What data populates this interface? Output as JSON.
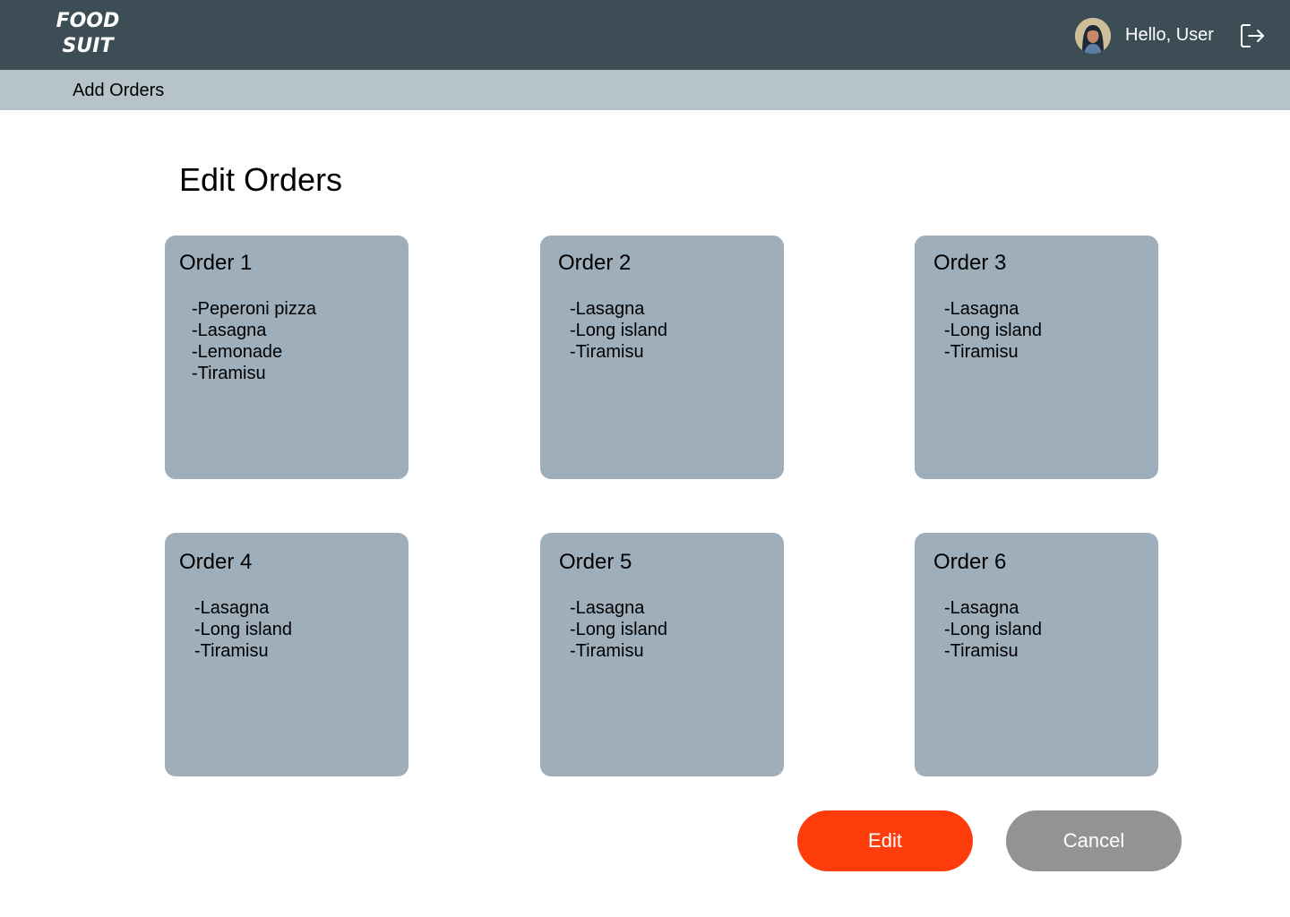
{
  "header": {
    "logo_line1": "FOOD",
    "logo_line2": "SUIT",
    "greeting": "Hello, User",
    "avatar_icon": "user-avatar",
    "logout_icon": "logout-icon",
    "background_color": "#3d4d55"
  },
  "subnav": {
    "add_orders_label": "Add Orders",
    "background_color": "#b6c3c8"
  },
  "main": {
    "title": "Edit Orders",
    "orders": [
      {
        "title": "Order 1",
        "items": [
          "-Peperoni pizza",
          "-Lasagna",
          "-Lemonade",
          "-Tiramisu"
        ]
      },
      {
        "title": "Order 2",
        "items": [
          "-Lasagna",
          "-Long island",
          "-Tiramisu"
        ]
      },
      {
        "title": "Order 3",
        "items": [
          "-Lasagna",
          "-Long island",
          "-Tiramisu"
        ]
      },
      {
        "title": "Order 4",
        "items": [
          "-Lasagna",
          "-Long island",
          "-Tiramisu"
        ]
      },
      {
        "title": "Order 5",
        "items": [
          "-Lasagna",
          "-Long island",
          "-Tiramisu"
        ]
      },
      {
        "title": "Order 6",
        "items": [
          "-Lasagna",
          "-Long island",
          "-Tiramisu"
        ]
      }
    ],
    "card_color": "#9faebb"
  },
  "actions": {
    "edit_label": "Edit",
    "cancel_label": "Cancel",
    "edit_color": "#ff3d0c",
    "cancel_color": "#939396"
  }
}
